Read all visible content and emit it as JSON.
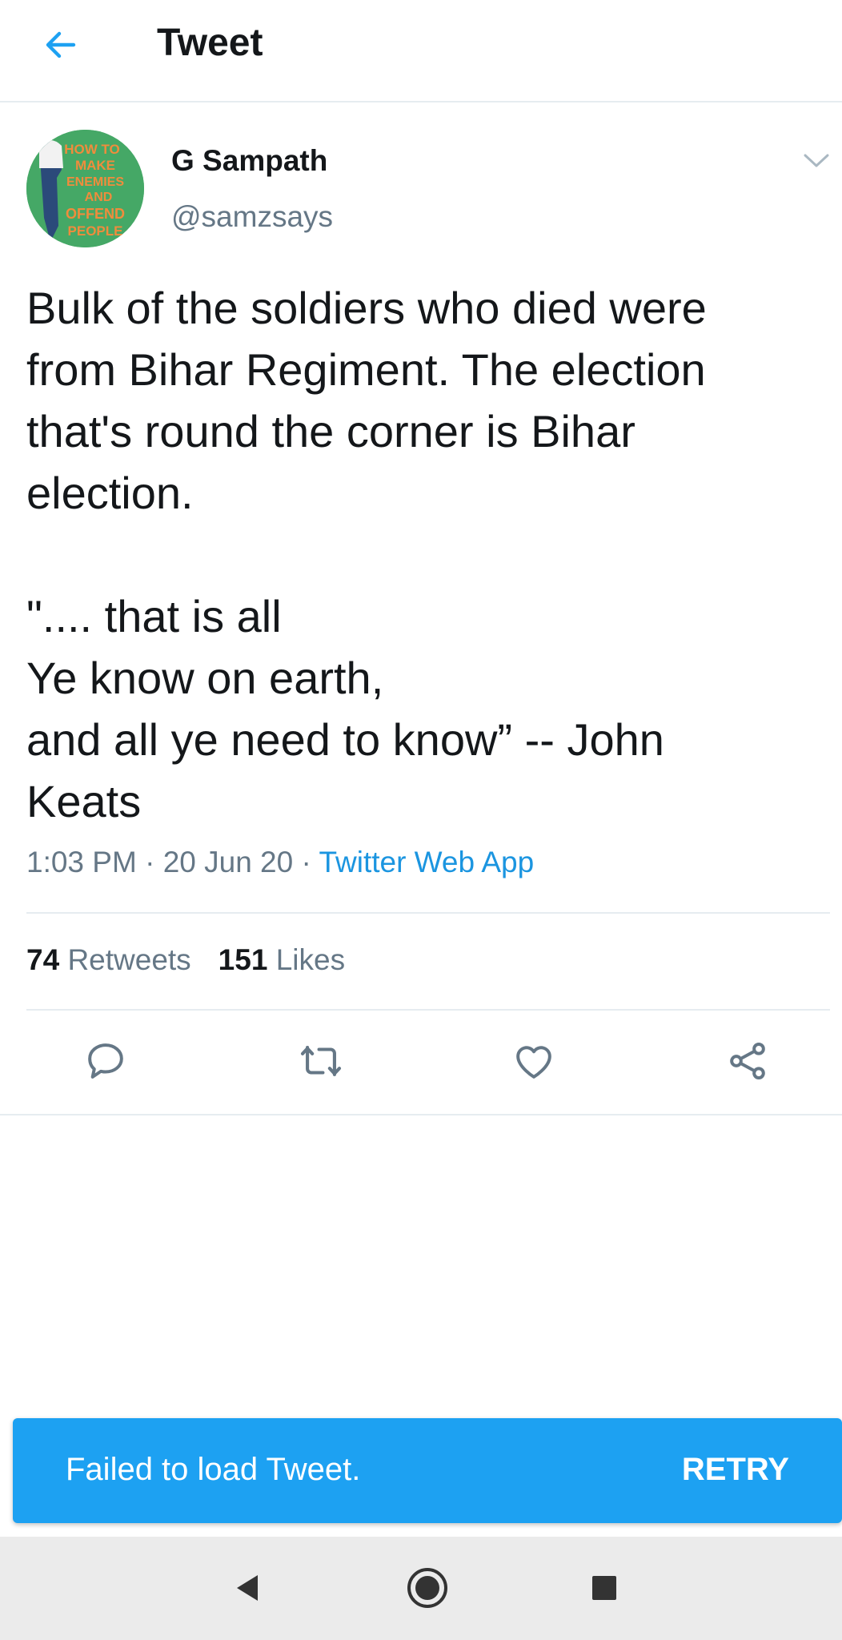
{
  "header": {
    "title": "Tweet",
    "back_icon": "arrow-left-icon"
  },
  "author": {
    "name": "G Sampath",
    "handle": "@samzsays",
    "avatar_text": [
      "HOW TO",
      "MAKE",
      "ENEMIES",
      "AND",
      "OFFEND",
      "PEOPLE"
    ]
  },
  "tweet": {
    "text": "Bulk of the soldiers who died were\nfrom Bihar Regiment. The election\nthat's round the corner is Bihar\nelection.\n\n\".... that is all\nYe know on earth,\nand all ye need to know” -- John\nKeats"
  },
  "meta": {
    "time": "1:03 PM",
    "separator": " · ",
    "date": "20 Jun 20",
    "source": "Twitter Web App"
  },
  "stats": {
    "retweets_count": "74",
    "retweets_label": "Retweets",
    "likes_count": "151",
    "likes_label": "Likes"
  },
  "actions": {
    "reply_icon": "reply-icon",
    "retweet_icon": "retweet-icon",
    "like_icon": "heart-icon",
    "share_icon": "share-icon"
  },
  "snackbar": {
    "message": "Failed to load Tweet.",
    "action": "RETRY"
  },
  "colors": {
    "accent": "#1da1f2",
    "link": "#1b95e0",
    "secondary_text": "#657786",
    "divider": "#e6ecf0"
  }
}
